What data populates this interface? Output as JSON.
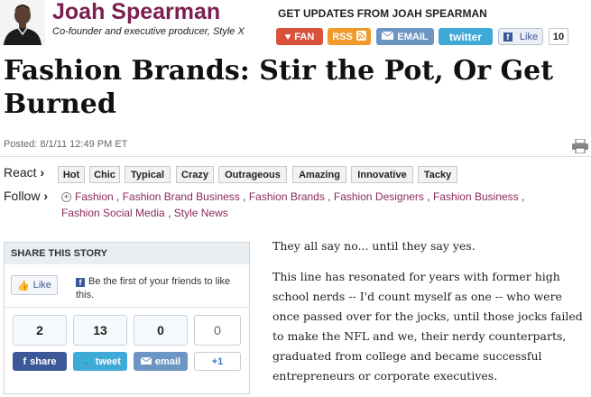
{
  "author": {
    "name": "Joah Spearman",
    "role": "Co-founder and executive producer, Style X"
  },
  "social": {
    "updates_heading": "GET UPDATES FROM JOAH SPEARMAN",
    "fan_label": "FAN",
    "rss_label": "RSS",
    "email_label": "EMAIL",
    "twitter_label": "twitter",
    "like_label": "Like",
    "like_count": "10"
  },
  "article": {
    "headline": "Fashion Brands: Stir the Pot, Or Get Burned",
    "posted": "Posted: 8/1/11 12:49 PM ET",
    "paragraphs": [
      "They all say no... until they say yes.",
      "This line has resonated for years with former high school nerds -- I'd count myself as one -- who were once passed over for the jocks, until those jocks failed to make the NFL and we, their nerdy counterparts, graduated from college and became successful entrepreneurs or corporate executives."
    ]
  },
  "react": {
    "label": "React",
    "tags": [
      "Hot",
      "Chic",
      "Typical",
      "Crazy",
      "Outrageous",
      "Amazing",
      "Innovative",
      "Tacky"
    ]
  },
  "follow": {
    "label": "Follow",
    "tags": [
      "Fashion",
      "Fashion Brand Business",
      "Fashion Brands",
      "Fashion Designers",
      "Fashion Business",
      "Fashion Social Media",
      "Style News"
    ]
  },
  "share": {
    "title": "SHARE THIS STORY",
    "like_label": "Like",
    "fb_text": "Be the first of your friends to like this.",
    "counts": {
      "facebook": "2",
      "twitter": "13",
      "email": "0",
      "google": "0"
    },
    "buttons": {
      "facebook": "share",
      "twitter": "tweet",
      "email": "email",
      "google": "+1"
    }
  },
  "colors": {
    "author": "#7a1f4f",
    "tag_link": "#8a2a5c",
    "fan": "#d9533c",
    "rss": "#f09a2c",
    "email": "#6d95c3",
    "twitter": "#3fa9d8",
    "facebook": "#3b5998"
  }
}
